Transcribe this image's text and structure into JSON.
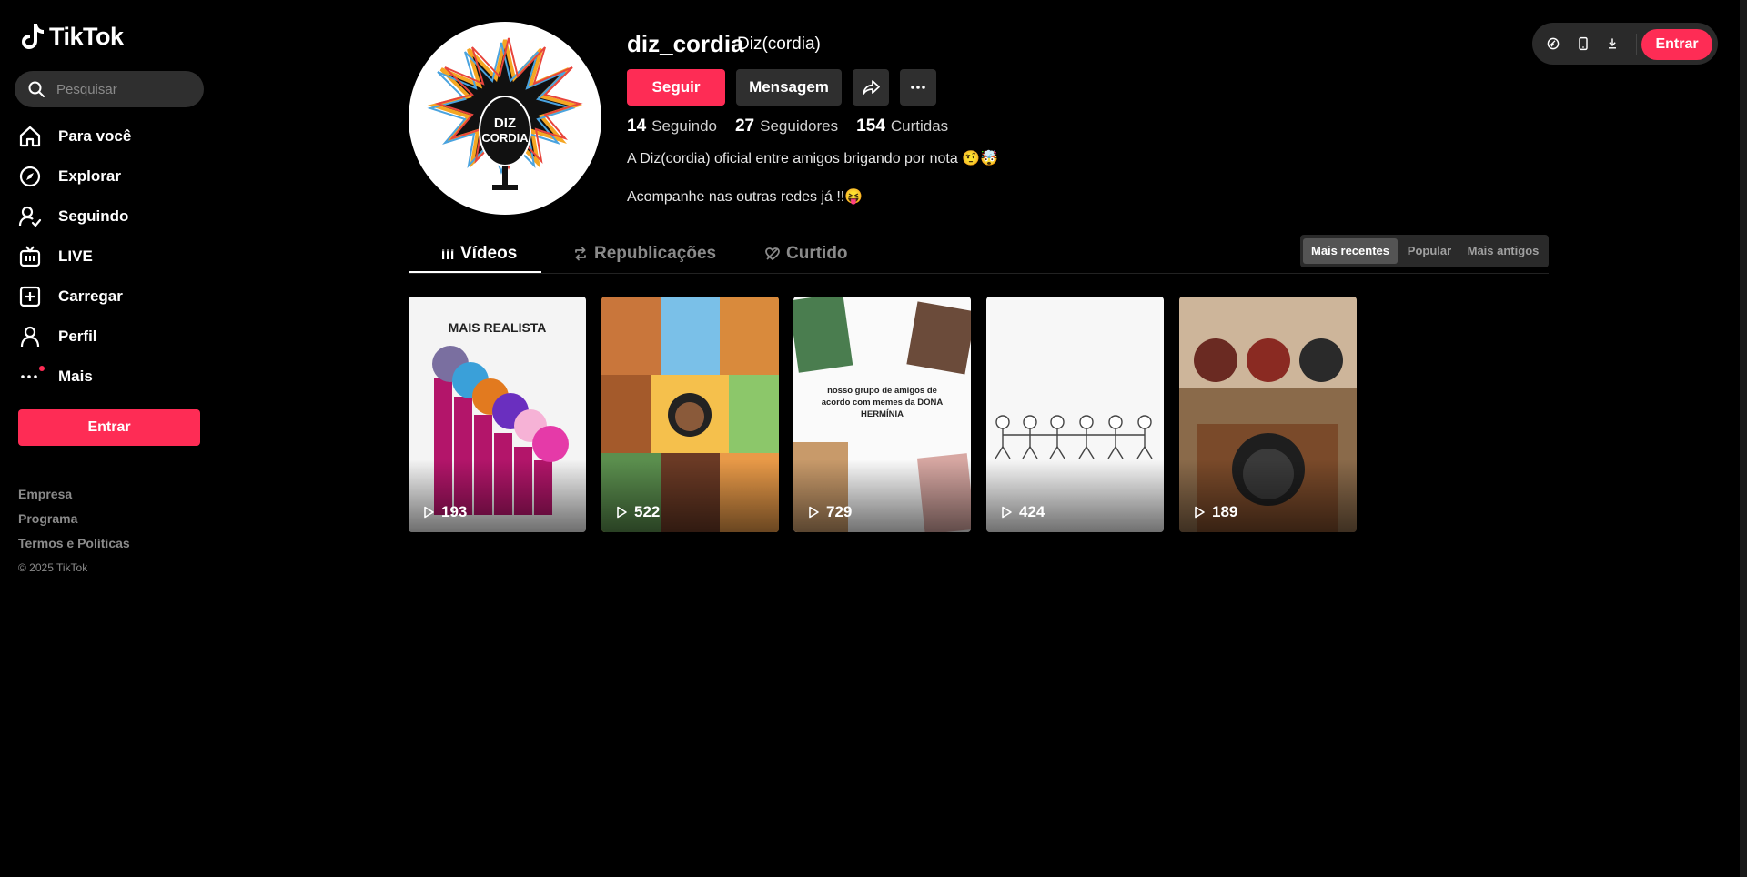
{
  "brand": {
    "name": "TikTok",
    "accent": "#fe2c55"
  },
  "search": {
    "placeholder": "Pesquisar"
  },
  "nav": [
    {
      "label": "Para você",
      "icon": "home-icon"
    },
    {
      "label": "Explorar",
      "icon": "compass-icon"
    },
    {
      "label": "Seguindo",
      "icon": "following-icon"
    },
    {
      "label": "LIVE",
      "icon": "live-icon"
    },
    {
      "label": "Carregar",
      "icon": "upload-icon"
    },
    {
      "label": "Perfil",
      "icon": "profile-icon"
    },
    {
      "label": "Mais",
      "icon": "more-icon"
    }
  ],
  "sidebar": {
    "login_label": "Entrar",
    "footer": [
      "Empresa",
      "Programa",
      "Termos e Políticas"
    ],
    "copyright": "© 2025 TikTok"
  },
  "topbar": {
    "login_label": "Entrar"
  },
  "profile": {
    "username": "diz_cordia",
    "nickname": "Diz(cordia)",
    "follow_label": "Seguir",
    "message_label": "Mensagem",
    "stats": {
      "following": "14",
      "following_label": "Seguindo",
      "followers": "27",
      "followers_label": "Seguidores",
      "likes": "154",
      "likes_label": "Curtidas"
    },
    "bio_line1": "A Diz(cordia) oficial entre amigos brigando por nota 🤨🤯",
    "bio_line2": "Acompanhe nas outras redes já !!😝",
    "avatar_text": "DIZ CORDIA"
  },
  "tabs": [
    {
      "label": "Vídeos",
      "active": true
    },
    {
      "label": "Republicações",
      "active": false
    },
    {
      "label": "Curtido",
      "active": false
    }
  ],
  "sort": [
    {
      "label": "Mais recentes",
      "active": true
    },
    {
      "label": "Popular",
      "active": false
    },
    {
      "label": "Mais antigos",
      "active": false
    }
  ],
  "videos": [
    {
      "views": "193",
      "caption": "MAIS REALISTA"
    },
    {
      "views": "522",
      "caption": ""
    },
    {
      "views": "729",
      "caption": "nosso grupo de amigos de acordo com memes da DONA HERMÍNIA"
    },
    {
      "views": "424",
      "caption": ""
    },
    {
      "views": "189",
      "caption": ""
    }
  ]
}
